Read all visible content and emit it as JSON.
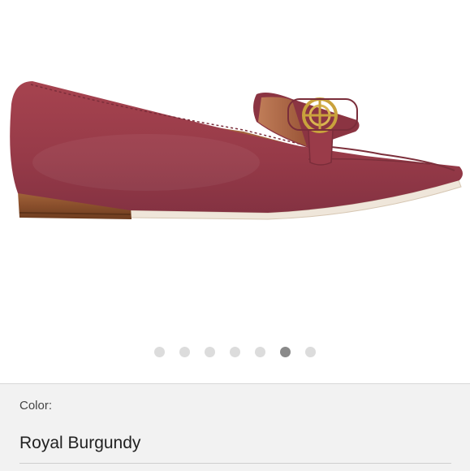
{
  "product": {
    "image_alt": "Burgundy suede loafer with gold emblem",
    "shoe_color": "#9b3c4b",
    "heel_color": "#8a4f2c",
    "emblem_color": "#c9a23c"
  },
  "carousel": {
    "dot_count": 7,
    "active_index": 5
  },
  "color_selector": {
    "label": "Color:",
    "value": "Royal Burgundy"
  }
}
